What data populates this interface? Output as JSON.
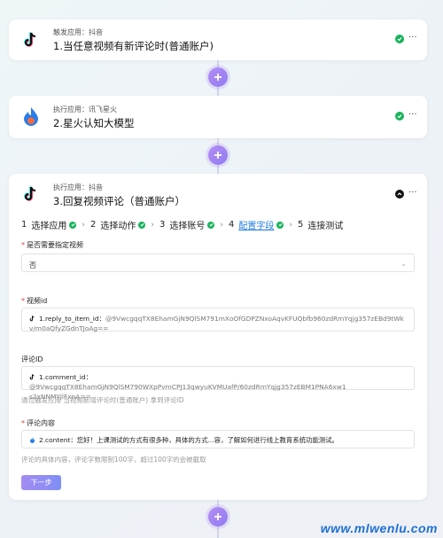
{
  "step1": {
    "app_label": "触发应用：抖音",
    "title": "1.当任意视频有新评论时(普通账户)",
    "more": "···",
    "icon": "tiktok-icon"
  },
  "step2": {
    "app_label": "执行应用：讯飞星火",
    "title": "2.星火认知大模型",
    "more": "···",
    "icon": "spark-icon"
  },
  "step3": {
    "app_label": "执行应用：抖音",
    "title": "3.回复视频评论（普通账户）",
    "more": "···",
    "icon": "tiktok-icon"
  },
  "wizard": {
    "steps": [
      {
        "num": "1",
        "label": "选择应用",
        "done": true
      },
      {
        "num": "2",
        "label": "选择动作",
        "done": true
      },
      {
        "num": "3",
        "label": "选择账号",
        "done": true
      },
      {
        "num": "4",
        "label": "配置字段",
        "done": true,
        "active": true
      },
      {
        "num": "5",
        "label": "连接测试",
        "done": false
      }
    ],
    "separator": "›"
  },
  "form": {
    "specify_video": {
      "label": "是否需要指定视频",
      "value": "否"
    },
    "video_id": {
      "label": "视频id",
      "token": "1.reply_to_item_id",
      "value_line1": "@9VwcgqqTX8EhamGjN9QlSM791mXoOfGDPZNxoAqvKFUQbfb960zdRmYqjg357zEBd9tWk",
      "value_line2": "v/m0aQfyZGdnTJoAg=="
    },
    "comment_id": {
      "label": "评论ID",
      "token": "1.comment_id",
      "value_line1": "@9VwcgqqTX8EhamGjN9QlSM790WXpPvmCPJ13qwyuKVMUafP/60zdRmYqjg357zEBM1PNA6xw1",
      "value_line2": "s2xNNMYjlFxnA==",
      "hint": "通过触发应用 当视频新增评论时(普通账户) 拿到评论ID"
    },
    "content": {
      "label": "评论内容",
      "token": "2.content",
      "value": "您好！上课测试的方式有很多种，具体的方式...容，了解如何进行线上教育系统功能测试。",
      "hint": "评论的具体内容，评论字数限制100字，超过100字的会被截取"
    },
    "next_label": "下一步"
  },
  "watermark": "www.mlwenlu.com",
  "colors": {
    "accent": "#1f7de0",
    "success": "#19b35c",
    "plus": "#a48bf3",
    "required": "#e23b3b"
  }
}
